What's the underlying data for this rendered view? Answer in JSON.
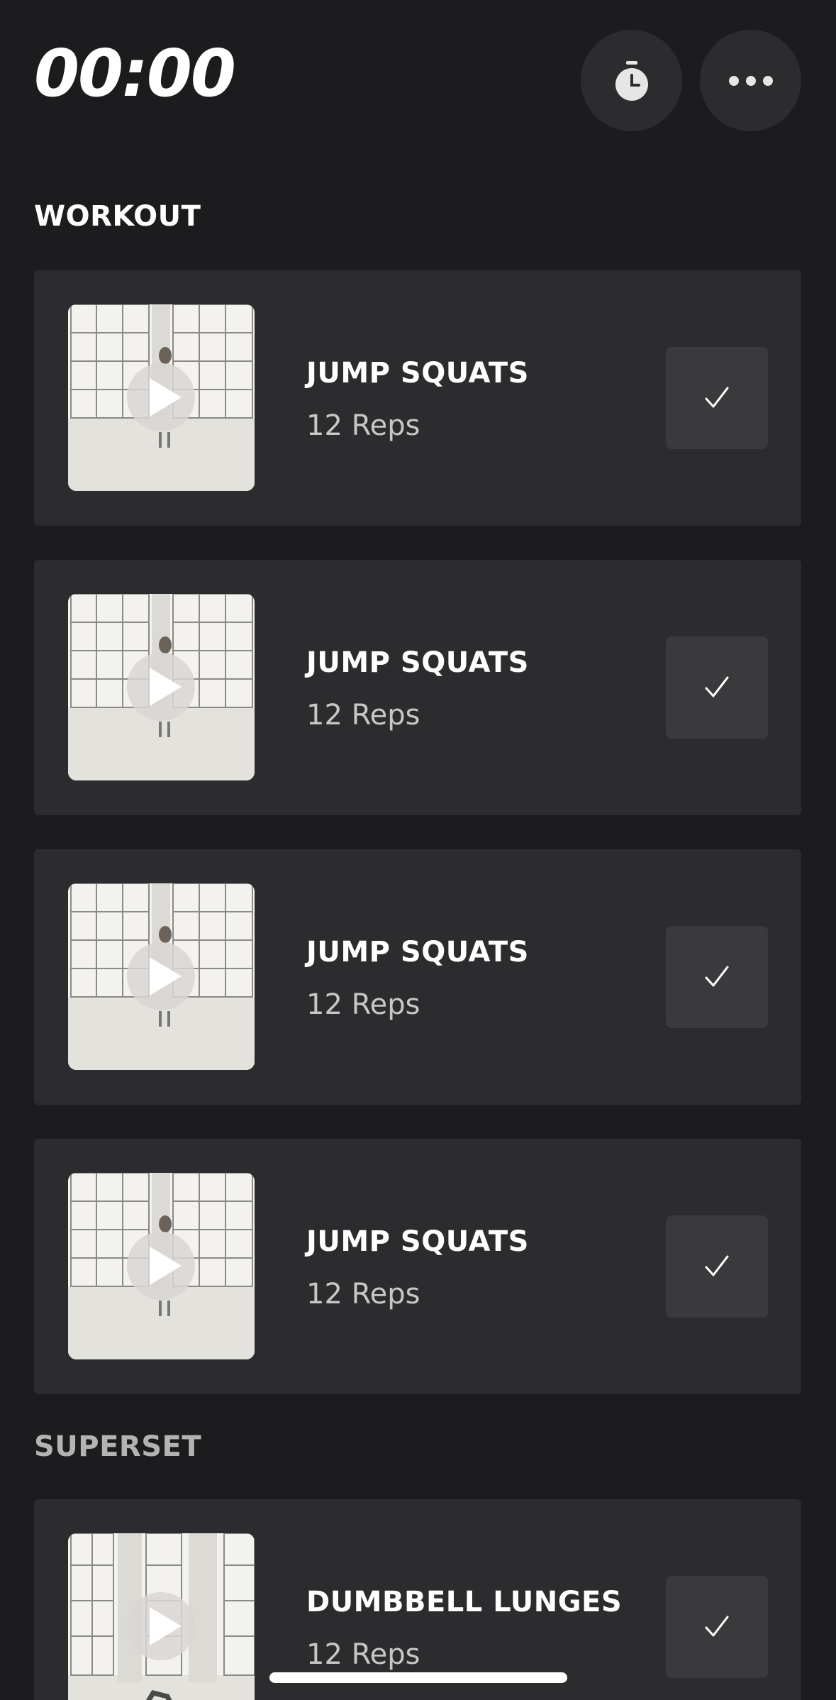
{
  "header": {
    "timer": "00:00",
    "stopwatch_icon": "stopwatch-icon",
    "more_icon": "more-horizontal-icon"
  },
  "sections": {
    "workout": "WORKOUT",
    "superset": "SUPERSET"
  },
  "workout_items": [
    {
      "name": "JUMP SQUATS",
      "reps": "12 Reps",
      "icon": "play-icon",
      "done": false
    },
    {
      "name": "JUMP SQUATS",
      "reps": "12 Reps",
      "icon": "play-icon",
      "done": false
    },
    {
      "name": "JUMP SQUATS",
      "reps": "12 Reps",
      "icon": "play-icon",
      "done": false
    },
    {
      "name": "JUMP SQUATS",
      "reps": "12 Reps",
      "icon": "play-icon",
      "done": false
    }
  ],
  "superset_items": [
    {
      "name": "DUMBBELL LUNGES",
      "reps": "12 Reps",
      "icon": "play-icon",
      "done": false
    }
  ],
  "colors": {
    "background": "#1c1c1e",
    "card": "#2c2c2e",
    "check_button": "#3a3a3c",
    "text_primary": "#ffffff",
    "text_secondary": "#c7c7c7"
  }
}
